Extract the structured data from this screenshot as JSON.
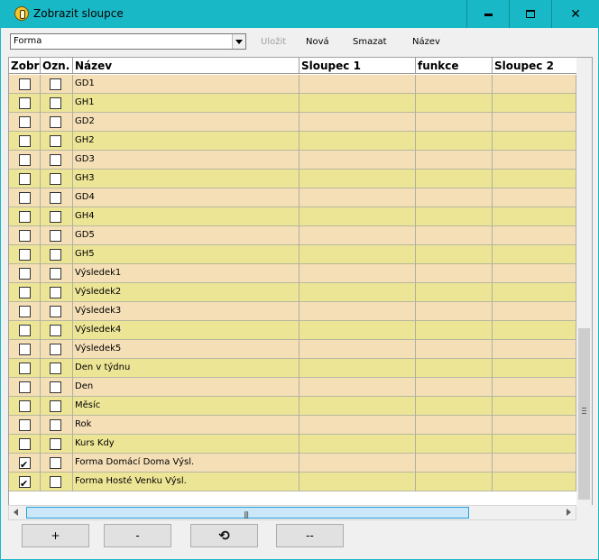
{
  "window": {
    "title": "Zobrazit sloupce",
    "controls": {
      "minimize": "minimize-icon",
      "maximize": "maximize-icon",
      "close": "close-icon"
    }
  },
  "toolbar": {
    "combo_value": "Forma",
    "save_label": "Uložit",
    "new_label": "Nová",
    "delete_label": "Smazat",
    "name_label": "Název"
  },
  "table": {
    "columns": [
      "Zobr",
      "Ozn.",
      "Název",
      "Sloupec 1",
      "funkce",
      "Sloupec 2"
    ],
    "rows": [
      {
        "zobr": false,
        "ozn": false,
        "nazev": "GD1"
      },
      {
        "zobr": false,
        "ozn": false,
        "nazev": "GH1"
      },
      {
        "zobr": false,
        "ozn": false,
        "nazev": "GD2"
      },
      {
        "zobr": false,
        "ozn": false,
        "nazev": "GH2"
      },
      {
        "zobr": false,
        "ozn": false,
        "nazev": "GD3"
      },
      {
        "zobr": false,
        "ozn": false,
        "nazev": "GH3"
      },
      {
        "zobr": false,
        "ozn": false,
        "nazev": "GD4"
      },
      {
        "zobr": false,
        "ozn": false,
        "nazev": "GH4"
      },
      {
        "zobr": false,
        "ozn": false,
        "nazev": "GD5"
      },
      {
        "zobr": false,
        "ozn": false,
        "nazev": "GH5"
      },
      {
        "zobr": false,
        "ozn": false,
        "nazev": "Výsledek1"
      },
      {
        "zobr": false,
        "ozn": false,
        "nazev": "Výsledek2"
      },
      {
        "zobr": false,
        "ozn": false,
        "nazev": "Výsledek3"
      },
      {
        "zobr": false,
        "ozn": false,
        "nazev": "Výsledek4"
      },
      {
        "zobr": false,
        "ozn": false,
        "nazev": "Výsledek5"
      },
      {
        "zobr": false,
        "ozn": false,
        "nazev": "Den v týdnu"
      },
      {
        "zobr": false,
        "ozn": false,
        "nazev": "Den"
      },
      {
        "zobr": false,
        "ozn": false,
        "nazev": "Měsíc"
      },
      {
        "zobr": false,
        "ozn": false,
        "nazev": "Rok"
      },
      {
        "zobr": false,
        "ozn": false,
        "nazev": "Kurs Kdy"
      },
      {
        "zobr": true,
        "ozn": false,
        "nazev": "Forma Domácí Doma Výsl."
      },
      {
        "zobr": true,
        "ozn": false,
        "nazev": "Forma Hosté Venku Výsl."
      }
    ],
    "row_colors": {
      "odd": "#f5dfb6",
      "even": "#ede596"
    }
  },
  "bottom": {
    "add_label": "+",
    "remove_label": "-",
    "refresh_icon": "refresh-icon",
    "remove_all_label": "--"
  },
  "colors": {
    "titlebar": "#19b8c6",
    "scroll_thumb_active": "#cce8f8"
  }
}
